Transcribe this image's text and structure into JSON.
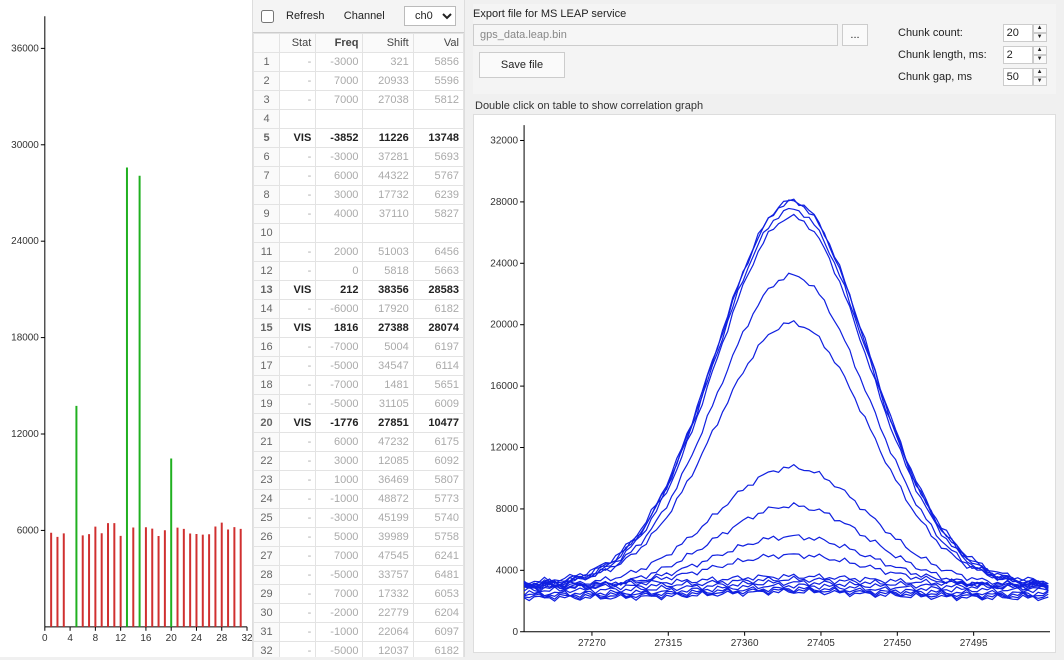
{
  "mid": {
    "refresh_label": "Refresh",
    "channel_label": "Channel",
    "channel_value": "ch0",
    "headers": {
      "idx": "",
      "stat": "Stat",
      "freq": "Freq",
      "shift": "Shift",
      "val": "Val"
    },
    "rows": [
      {
        "i": 1,
        "stat": "-",
        "freq": "-3000",
        "shift": "321",
        "val": "5856"
      },
      {
        "i": 2,
        "stat": "-",
        "freq": "7000",
        "shift": "20933",
        "val": "5596"
      },
      {
        "i": 3,
        "stat": "-",
        "freq": "7000",
        "shift": "27038",
        "val": "5812"
      },
      {
        "i": 4,
        "stat": "",
        "freq": "",
        "shift": "",
        "val": ""
      },
      {
        "i": 5,
        "stat": "VIS",
        "freq": "-3852",
        "shift": "11226",
        "val": "13748",
        "bold": true
      },
      {
        "i": 6,
        "stat": "-",
        "freq": "-3000",
        "shift": "37281",
        "val": "5693"
      },
      {
        "i": 7,
        "stat": "-",
        "freq": "6000",
        "shift": "44322",
        "val": "5767"
      },
      {
        "i": 8,
        "stat": "-",
        "freq": "3000",
        "shift": "17732",
        "val": "6239"
      },
      {
        "i": 9,
        "stat": "-",
        "freq": "4000",
        "shift": "37110",
        "val": "5827"
      },
      {
        "i": 10,
        "stat": "",
        "freq": "",
        "shift": "",
        "val": ""
      },
      {
        "i": 11,
        "stat": "-",
        "freq": "2000",
        "shift": "51003",
        "val": "6456"
      },
      {
        "i": 12,
        "stat": "-",
        "freq": "0",
        "shift": "5818",
        "val": "5663"
      },
      {
        "i": 13,
        "stat": "VIS",
        "freq": "212",
        "shift": "38356",
        "val": "28583",
        "bold": true
      },
      {
        "i": 14,
        "stat": "-",
        "freq": "-6000",
        "shift": "17920",
        "val": "6182"
      },
      {
        "i": 15,
        "stat": "VIS",
        "freq": "1816",
        "shift": "27388",
        "val": "28074",
        "bold": true
      },
      {
        "i": 16,
        "stat": "-",
        "freq": "-7000",
        "shift": "5004",
        "val": "6197"
      },
      {
        "i": 17,
        "stat": "-",
        "freq": "-5000",
        "shift": "34547",
        "val": "6114"
      },
      {
        "i": 18,
        "stat": "-",
        "freq": "-7000",
        "shift": "1481",
        "val": "5651"
      },
      {
        "i": 19,
        "stat": "-",
        "freq": "-5000",
        "shift": "31105",
        "val": "6009"
      },
      {
        "i": 20,
        "stat": "VIS",
        "freq": "-1776",
        "shift": "27851",
        "val": "10477",
        "bold": true
      },
      {
        "i": 21,
        "stat": "-",
        "freq": "6000",
        "shift": "47232",
        "val": "6175"
      },
      {
        "i": 22,
        "stat": "-",
        "freq": "3000",
        "shift": "12085",
        "val": "6092"
      },
      {
        "i": 23,
        "stat": "-",
        "freq": "1000",
        "shift": "36469",
        "val": "5807"
      },
      {
        "i": 24,
        "stat": "-",
        "freq": "-1000",
        "shift": "48872",
        "val": "5773"
      },
      {
        "i": 25,
        "stat": "-",
        "freq": "-3000",
        "shift": "45199",
        "val": "5740"
      },
      {
        "i": 26,
        "stat": "-",
        "freq": "5000",
        "shift": "39989",
        "val": "5758"
      },
      {
        "i": 27,
        "stat": "-",
        "freq": "7000",
        "shift": "47545",
        "val": "6241"
      },
      {
        "i": 28,
        "stat": "-",
        "freq": "-5000",
        "shift": "33757",
        "val": "6481"
      },
      {
        "i": 29,
        "stat": "-",
        "freq": "7000",
        "shift": "17332",
        "val": "6053"
      },
      {
        "i": 30,
        "stat": "-",
        "freq": "-2000",
        "shift": "22779",
        "val": "6204"
      },
      {
        "i": 31,
        "stat": "-",
        "freq": "-1000",
        "shift": "22064",
        "val": "6097"
      },
      {
        "i": 32,
        "stat": "-",
        "freq": "-5000",
        "shift": "12037",
        "val": "6182"
      }
    ]
  },
  "export": {
    "title": "Export file for MS LEAP service",
    "path": "gps_data.leap.bin",
    "browse": "...",
    "save": "Save file",
    "params": {
      "chunk_count_label": "Chunk count:",
      "chunk_count": "20",
      "chunk_length_label": "Chunk length, ms:",
      "chunk_length": "2",
      "chunk_gap_label": "Chunk gap, ms",
      "chunk_gap": "50"
    }
  },
  "hint": "Double click on table to show correlation graph",
  "chart_data": [
    {
      "type": "bar",
      "name": "left-bar-chart",
      "x_ticks": [
        0,
        4,
        8,
        12,
        16,
        20,
        24,
        28,
        32
      ],
      "y_ticks": [
        6000,
        12000,
        18000,
        24000,
        30000,
        36000
      ],
      "xlim": [
        0,
        32
      ],
      "ylim": [
        0,
        38000
      ],
      "series": [
        {
          "name": "red",
          "color": "#d03030",
          "x": [
            1,
            2,
            3,
            6,
            7,
            8,
            9,
            10,
            11,
            12,
            14,
            16,
            17,
            18,
            19,
            21,
            22,
            23,
            24,
            25,
            26,
            27,
            28,
            29,
            30,
            31
          ],
          "values": [
            5856,
            5596,
            5812,
            5693,
            5767,
            6239,
            5827,
            6456,
            6456,
            5663,
            6182,
            6197,
            6114,
            5651,
            6009,
            6175,
            6092,
            5807,
            5773,
            5740,
            5758,
            6241,
            6481,
            6053,
            6204,
            6097
          ]
        },
        {
          "name": "green",
          "color": "#20b020",
          "x": [
            5,
            13,
            15,
            20
          ],
          "values": [
            13748,
            28583,
            28074,
            10477
          ]
        }
      ]
    },
    {
      "type": "line",
      "name": "correlation-graph",
      "x_ticks": [
        27270,
        27315,
        27360,
        27405,
        27450,
        27495
      ],
      "y_ticks": [
        0,
        4000,
        8000,
        12000,
        16000,
        20000,
        24000,
        28000,
        32000
      ],
      "xlim": [
        27230,
        27540
      ],
      "ylim": [
        0,
        33000
      ],
      "peak_x": 27388,
      "series": [
        {
          "name": "trace1",
          "color": "#1020e0",
          "peak": 28074,
          "base": 3200
        },
        {
          "name": "trace2",
          "color": "#1020e0",
          "peak": 28000,
          "base": 3000
        },
        {
          "name": "trace3",
          "color": "#1020e0",
          "peak": 27500,
          "base": 3100
        },
        {
          "name": "trace4",
          "color": "#1020e0",
          "peak": 27000,
          "base": 2900
        },
        {
          "name": "trace5",
          "color": "#1020e0",
          "peak": 23200,
          "base": 3000
        },
        {
          "name": "trace6",
          "color": "#1020e0",
          "peak": 20100,
          "base": 3100
        },
        {
          "name": "trace7",
          "color": "#1020e0",
          "peak": 10700,
          "base": 3000
        },
        {
          "name": "trace8",
          "color": "#1020e0",
          "peak": 8200,
          "base": 2800
        },
        {
          "name": "trace9",
          "color": "#1020e0",
          "peak": 6200,
          "base": 2900
        },
        {
          "name": "trace10",
          "color": "#1020e0",
          "peak": 5000,
          "base": 3000
        },
        {
          "name": "flat1",
          "color": "#1020e0",
          "peak": 3600,
          "base": 3100
        },
        {
          "name": "flat2",
          "color": "#1020e0",
          "peak": 3400,
          "base": 2900
        },
        {
          "name": "flat3",
          "color": "#1020e0",
          "peak": 3200,
          "base": 2700
        },
        {
          "name": "flat4",
          "color": "#1020e0",
          "peak": 3000,
          "base": 2500
        },
        {
          "name": "flat5",
          "color": "#1020e0",
          "peak": 2800,
          "base": 2400
        },
        {
          "name": "flat6",
          "color": "#1020e0",
          "peak": 2700,
          "base": 2300
        },
        {
          "name": "flat7",
          "color": "#1020e0",
          "peak": 2600,
          "base": 2200
        }
      ]
    }
  ]
}
